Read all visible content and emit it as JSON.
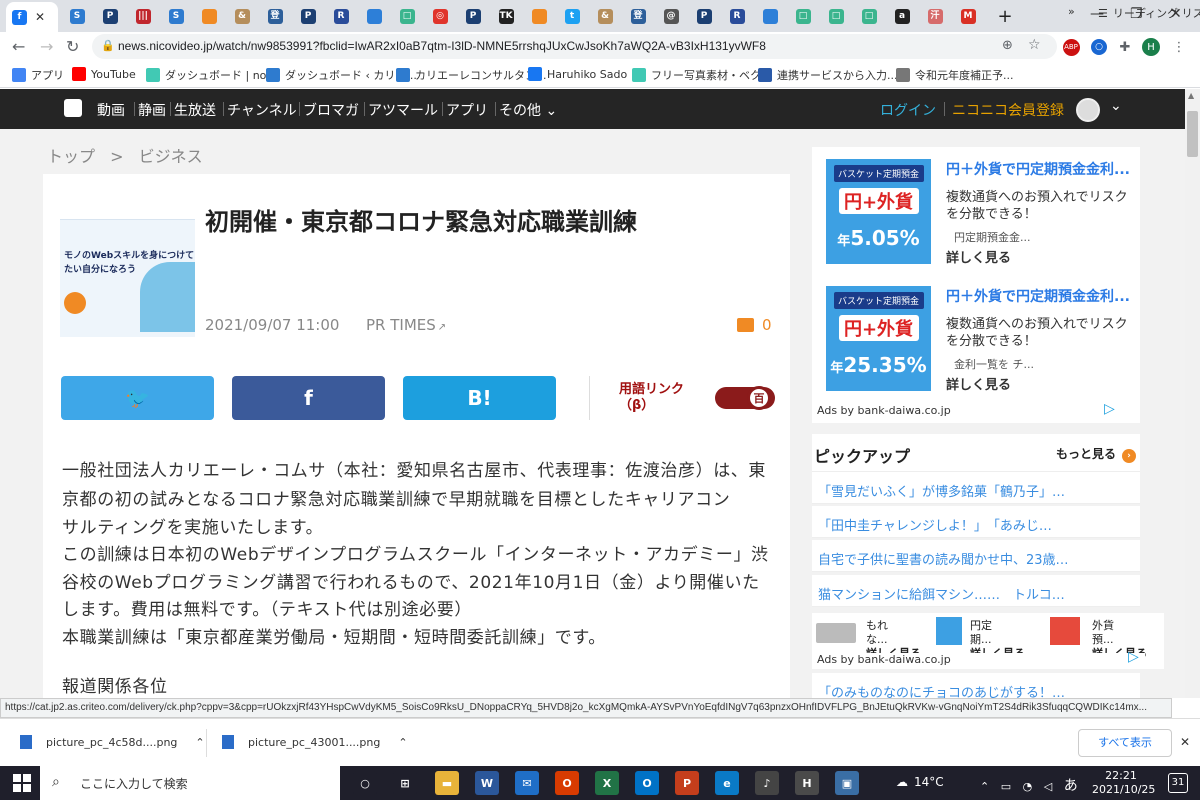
{
  "browser": {
    "tabs": [
      {
        "icon": "facebook-icon",
        "color": "#1877f2",
        "glyph": "f",
        "active": true
      },
      {
        "icon": "sync-icon",
        "color": "#2e7bcf",
        "glyph": "S"
      },
      {
        "icon": "p-icon",
        "color": "#1c3f72",
        "glyph": "P"
      },
      {
        "icon": "barcode-icon",
        "color": "#c0262d",
        "glyph": "|||"
      },
      {
        "icon": "sync-icon",
        "color": "#2e7bcf",
        "glyph": "S"
      },
      {
        "icon": "orange-box-icon",
        "color": "#f08a24",
        "glyph": ""
      },
      {
        "icon": "ampersand-icon",
        "color": "#b58e5c",
        "glyph": "&"
      },
      {
        "icon": "building-icon",
        "color": "#2d5f9a",
        "glyph": "登"
      },
      {
        "icon": "p-icon",
        "color": "#1c3f72",
        "glyph": "P"
      },
      {
        "icon": "r-icon",
        "color": "#2a4c9a",
        "glyph": "R"
      },
      {
        "icon": "circle-icon",
        "color": "#2d7fd8",
        "glyph": ""
      },
      {
        "icon": "green-box-icon",
        "color": "#3bb58e",
        "glyph": "□"
      },
      {
        "icon": "target-icon",
        "color": "#e0342b",
        "glyph": "◎"
      },
      {
        "icon": "p-icon",
        "color": "#1c3f72",
        "glyph": "P"
      },
      {
        "icon": "tk-icon",
        "color": "#222222",
        "glyph": "TK"
      },
      {
        "icon": "orange-box-icon",
        "color": "#f08a24",
        "glyph": ""
      },
      {
        "icon": "twitter-icon",
        "color": "#1da1f2",
        "glyph": "t"
      },
      {
        "icon": "ampersand-icon",
        "color": "#b58e5c",
        "glyph": "&"
      },
      {
        "icon": "building-icon",
        "color": "#2d5f9a",
        "glyph": "登"
      },
      {
        "icon": "at-icon",
        "color": "#555555",
        "glyph": "@"
      },
      {
        "icon": "p-icon",
        "color": "#1c3f72",
        "glyph": "P"
      },
      {
        "icon": "r-icon",
        "color": "#2a4c9a",
        "glyph": "R"
      },
      {
        "icon": "circle-icon",
        "color": "#2d7fd8",
        "glyph": ""
      },
      {
        "icon": "green-box-icon",
        "color": "#3bb58e",
        "glyph": "□"
      },
      {
        "icon": "green-box-icon",
        "color": "#3bb58e",
        "glyph": "□"
      },
      {
        "icon": "green-box-icon",
        "color": "#3bb58e",
        "glyph": "□"
      },
      {
        "icon": "amazon-icon",
        "color": "#222222",
        "glyph": "a"
      },
      {
        "icon": "kanji-icon",
        "color": "#d66b6b",
        "glyph": "汗"
      },
      {
        "icon": "gmail-icon",
        "color": "#d93025",
        "glyph": "M"
      }
    ],
    "url": "news.nicovideo.jp/watch/nw9853991?fbclid=IwAR2xI0aB7qtm-I3lD-NMNE5rrshqJUxCwJsoKh7aWQ2A-vB3IxH131yvWF8",
    "profile_initial": "H",
    "bookmarks": [
      {
        "label": "アプリ",
        "icon": "apps-grid-icon",
        "color": "#4285f4"
      },
      {
        "label": "YouTube",
        "icon": "youtube-icon",
        "color": "#ff0000"
      },
      {
        "label": "ダッシュボード | note",
        "icon": "note-icon",
        "color": "#41c9b4"
      },
      {
        "label": "ダッシュボード ‹ カリエ...",
        "icon": "sync-icon",
        "color": "#2e7bcf"
      },
      {
        "label": "カリエーレコンサルタン...",
        "icon": "sync-icon",
        "color": "#2e7bcf"
      },
      {
        "label": "Haruhiko Sado",
        "icon": "facebook-icon",
        "color": "#1877f2"
      },
      {
        "label": "フリー写真素材・ベク...",
        "icon": "photo-icon",
        "color": "#41c9b4"
      },
      {
        "label": "連携サービスから入力...",
        "icon": "link-icon",
        "color": "#2a5aa8"
      },
      {
        "label": "令和元年度補正予...",
        "icon": "globe-icon",
        "color": "#777777"
      }
    ],
    "reading_list": "リーディング リスト"
  },
  "nico": {
    "nav": [
      "動画",
      "静画",
      "生放送",
      "チャンネル",
      "ブロマガ",
      "アツマール",
      "アプリ",
      "その他"
    ],
    "login": "ログイン",
    "register": "ニコニコ会員登録"
  },
  "breadcrumb": {
    "top": "トップ",
    "sep": ">",
    "category": "ビジネス"
  },
  "article": {
    "title": "初開催・東京都コロナ緊急対応職業訓練",
    "date": "2021/09/07 11:00",
    "source": "PR TIMES",
    "comments": "0",
    "thumb_text_1": "モノのWebスキルを身につけて",
    "thumb_text_2": "たい自分になろう",
    "share_twitter": "twitter-icon",
    "share_facebook": "f",
    "share_hatena": "B!",
    "glossary_label": "用語リンク",
    "glossary_beta": "（β）",
    "glossary_toggle": "百",
    "paragraphs": [
      "一般社団法人カリエーレ・コムサ（本社：愛知県名古屋市、代表理事：佐渡治彦）は、東",
      "京都の初の試みとなるコロナ緊急対応職業訓練で早期就職を目標としたキャリアコン",
      "サルティングを実施いたします。",
      "この訓練は日本初のWebデザインプログラムスクール「インターネット・アカデミー」渋",
      "谷校のWebプログラミング講習で行われるもので、2021年10月1日（金）より開催いた",
      "します。費用は無料です。（テキスト代は別途必要）",
      "本職業訓練は「東京都産業労働局・短期間・短時間委託訓練」です。",
      "報道関係各位"
    ]
  },
  "sidebar": {
    "ads": [
      {
        "title": "円＋外貨で円定期預金金利...",
        "desc": "複数通貨へのお預入れでリスクを分散できる！",
        "sub": "円定期預金金...",
        "more": "詳しく見る",
        "img_top": "バスケット定期預金",
        "img_main": "円+外貨",
        "img_rate_prefix": "年",
        "img_rate": "5.05%"
      },
      {
        "title": "円＋外貨で円定期預金金利...",
        "desc": "複数通貨へのお預入れでリスクを分散できる！",
        "sub": "金利一覧を チ...",
        "more": "詳しく見る",
        "img_top": "バスケット定期預金",
        "img_main": "円+外貨",
        "img_rate_prefix": "年",
        "img_rate": "25.35%"
      }
    ],
    "ads_by": "Ads by bank-daiwa.co.jp",
    "pickup_title": "ピックアップ",
    "pickup_more": "もっと見る",
    "pickup_items": [
      "「雪見だいふく」が博多銘菓「鶴乃子」…",
      "「田中圭チャレンジしよ！」　「あみじ…",
      "自宅で子供に聖書の読み聞かせ中、23歳…",
      "猫マンションに給餌マシン……　トルコ…"
    ],
    "mini_ads": [
      {
        "t1": "もれ",
        "t2": "な...",
        "more": "詳しく見る"
      },
      {
        "t1": "円定",
        "t2": "期...",
        "more": "詳しく見る"
      },
      {
        "t1": "外貨",
        "t2": "預...",
        "more": "詳しく見る"
      }
    ],
    "ads_by_2": "Ads by bank-daiwa.co.jp",
    "last_item": "「のみものなのにチョコのあじがする！…"
  },
  "status_url": "https://cat.jp2.as.criteo.com/delivery/ck.php?cppv=3&cpp=rUOkzxjRf43YHspCwVdyKM5_SoisCo9RksU_DNoppaCRYq_5HVD8j2o_kcXgMQmkA-AYSvPVnYoEqfdINgV7q63pnzxOHnfIDVFLPG_BnJEtuQkRVKw-vGnqNoiYmT2S4dRik3SfuqqCQWDIKc14mx...",
  "downloads": {
    "items": [
      "picture_pc_4c58d....png",
      "picture_pc_43001....png"
    ],
    "show_all": "すべて表示"
  },
  "taskbar": {
    "search_placeholder": "ここに入力して検索",
    "apps": [
      {
        "icon": "task-view-icon",
        "color": "#1f1f2b",
        "glyph": "○"
      },
      {
        "icon": "multitask-icon",
        "color": "#1f1f2b",
        "glyph": "⊞"
      },
      {
        "icon": "folder-icon",
        "color": "#e8b33a",
        "glyph": "▬"
      },
      {
        "icon": "word-icon",
        "color": "#2b579a",
        "glyph": "W"
      },
      {
        "icon": "mail-icon",
        "color": "#1f6ec7",
        "glyph": "✉"
      },
      {
        "icon": "office-icon",
        "color": "#d83b01",
        "glyph": "O"
      },
      {
        "icon": "excel-icon",
        "color": "#217346",
        "glyph": "X"
      },
      {
        "icon": "outlook-icon",
        "color": "#0072c6",
        "glyph": "O"
      },
      {
        "icon": "powerpoint-icon",
        "color": "#c43e1c",
        "glyph": "P"
      },
      {
        "icon": "edge-icon",
        "color": "#0a7ac6",
        "glyph": "e"
      },
      {
        "icon": "music-icon",
        "color": "#444444",
        "glyph": "♪"
      },
      {
        "icon": "chrome-icon",
        "color": "#4a4a4a",
        "glyph": "H"
      },
      {
        "icon": "photos-icon",
        "color": "#3a6ea5",
        "glyph": "▣"
      }
    ],
    "weather": "14°C",
    "ime": "あ",
    "time": "22:21",
    "date": "2021/10/25",
    "notifications": "31"
  }
}
